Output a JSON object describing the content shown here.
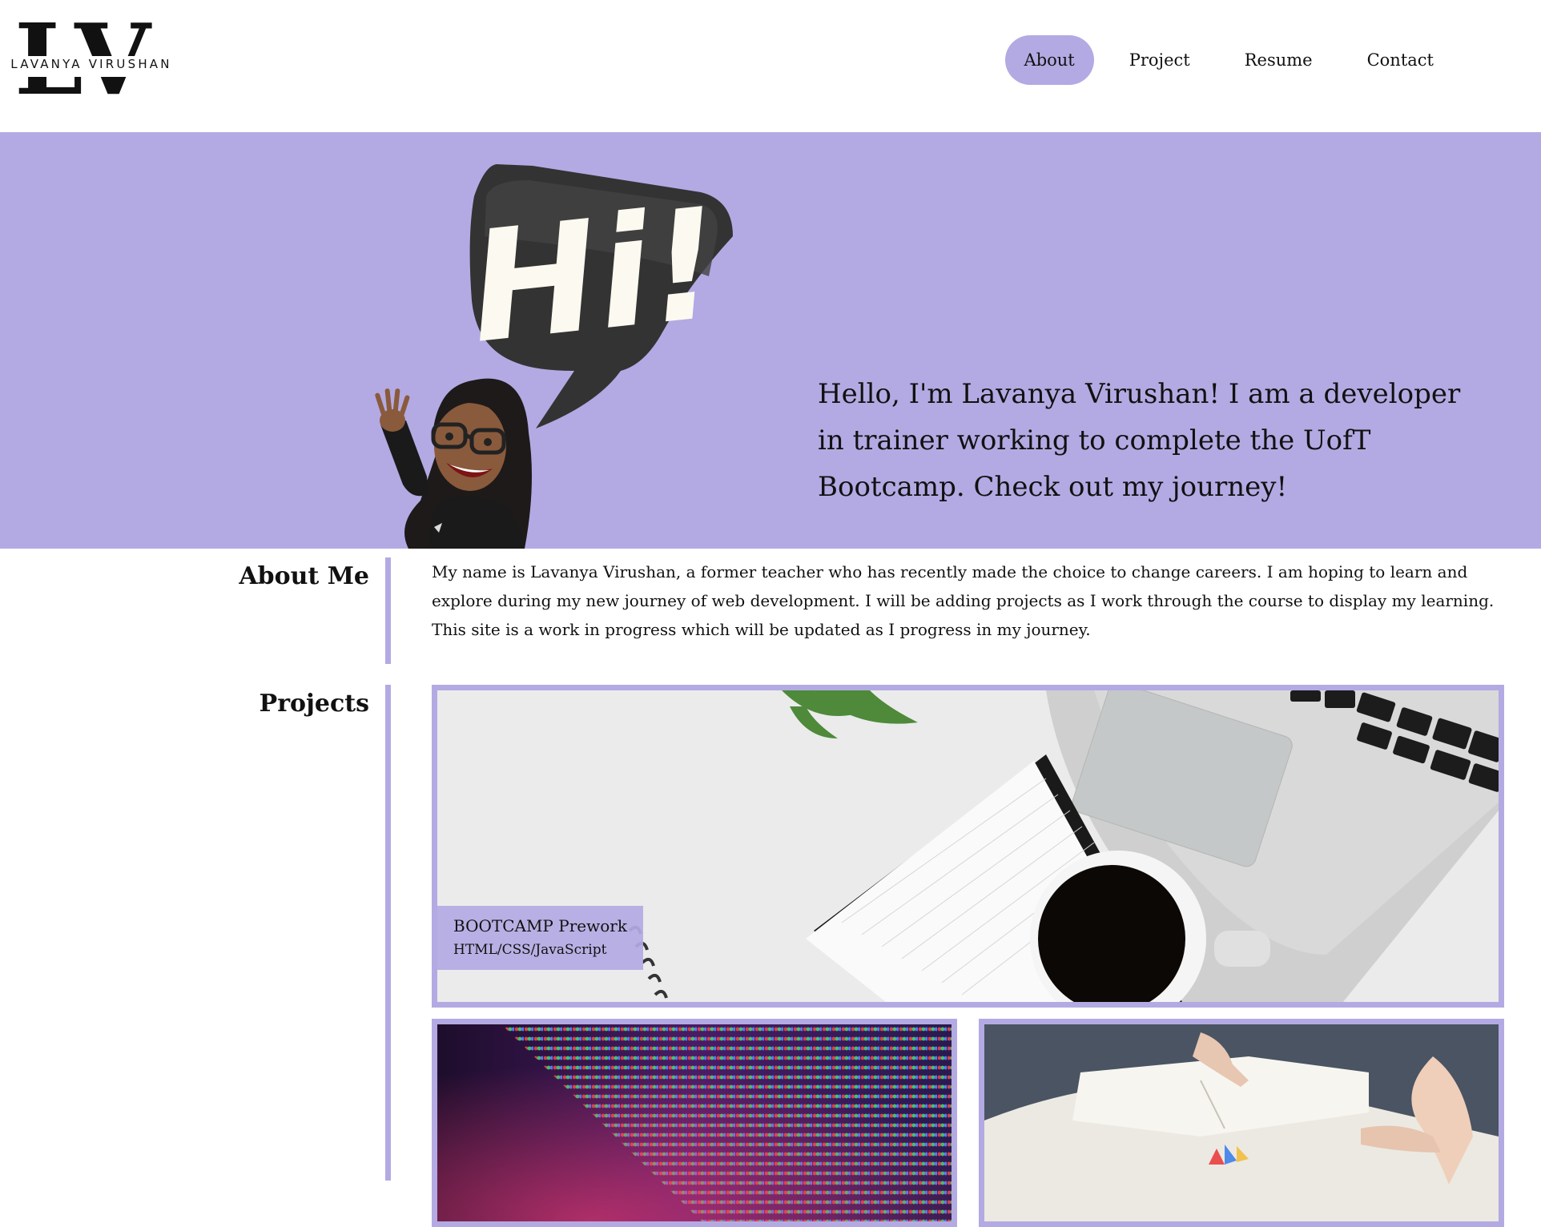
{
  "header": {
    "logo_monogram": "LV",
    "logo_name": "LAVANYA VIRUSHAN",
    "nav": [
      {
        "label": "About",
        "active": true
      },
      {
        "label": "Project",
        "active": false
      },
      {
        "label": "Resume",
        "active": false
      },
      {
        "label": "Contact",
        "active": false
      }
    ]
  },
  "hero": {
    "speech_bubble_text": "Hi!",
    "intro": "Hello, I'm Lavanya Virushan! I am a developer in trainer working to complete the UofT Bootcamp. Check out my journey!"
  },
  "about": {
    "title": "About Me",
    "body": "My name is Lavanya Virushan, a former teacher who has recently made the choice to change careers. I am hoping to learn and explore during my new journey of web development. I will be adding projects as I work through the course to display my learning. This site is a work in progress which will be updated as I progress in my journey."
  },
  "projects": {
    "title": "Projects",
    "items": [
      {
        "title": "BOOTCAMP Prework",
        "tech": "HTML/CSS/JavaScript"
      },
      {
        "title": "",
        "tech": ""
      },
      {
        "title": "",
        "tech": ""
      }
    ]
  },
  "theme": {
    "accent": "#b3aae3",
    "text": "#111111",
    "background": "#ffffff"
  }
}
